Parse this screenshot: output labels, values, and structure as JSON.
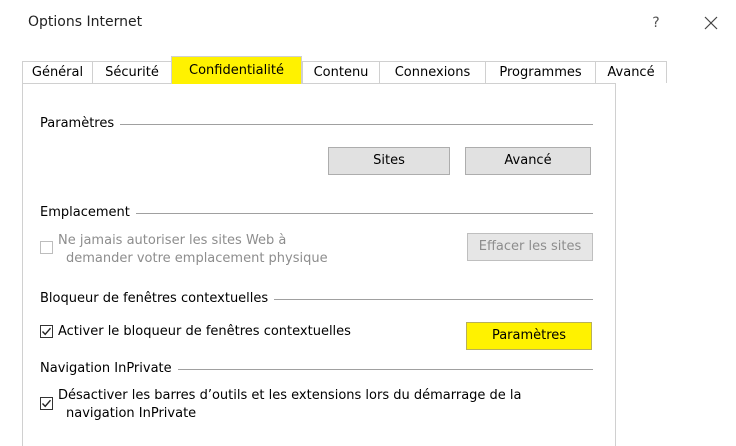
{
  "window": {
    "title": "Options Internet",
    "help_glyph": "?",
    "close_icon": "close-icon"
  },
  "tabs": [
    {
      "label": "Général"
    },
    {
      "label": "Sécurité"
    },
    {
      "label": "Confidentialité",
      "active": true
    },
    {
      "label": "Contenu"
    },
    {
      "label": "Connexions"
    },
    {
      "label": "Programmes"
    },
    {
      "label": "Avancé"
    }
  ],
  "sections": {
    "parametres": {
      "label": "Paramètres",
      "sites_button": "Sites",
      "avance_button": "Avancé"
    },
    "emplacement": {
      "label": "Emplacement",
      "checkbox_label_line1": "Ne jamais autoriser les sites Web à",
      "checkbox_label_line2": "demander votre emplacement physique",
      "checked": false,
      "enabled": false,
      "clear_button": "Effacer les sites"
    },
    "bloqueur": {
      "label": "Bloqueur de fenêtres contextuelles",
      "checkbox_label": "Activer le bloqueur de fenêtres contextuelles",
      "checked": true,
      "settings_button": "Paramètres"
    },
    "inprivate": {
      "label": "Navigation InPrivate",
      "checkbox_label_line1": "Désactiver les barres d’outils et les extensions lors du démarrage de la",
      "checkbox_label_line2": "navigation InPrivate",
      "checked": true
    }
  },
  "colors": {
    "highlight": "#fff200",
    "button_face": "#e1e1e1",
    "button_border": "#adadad",
    "disabled_text": "#8d8d8d",
    "divider": "#a0a0a0"
  }
}
